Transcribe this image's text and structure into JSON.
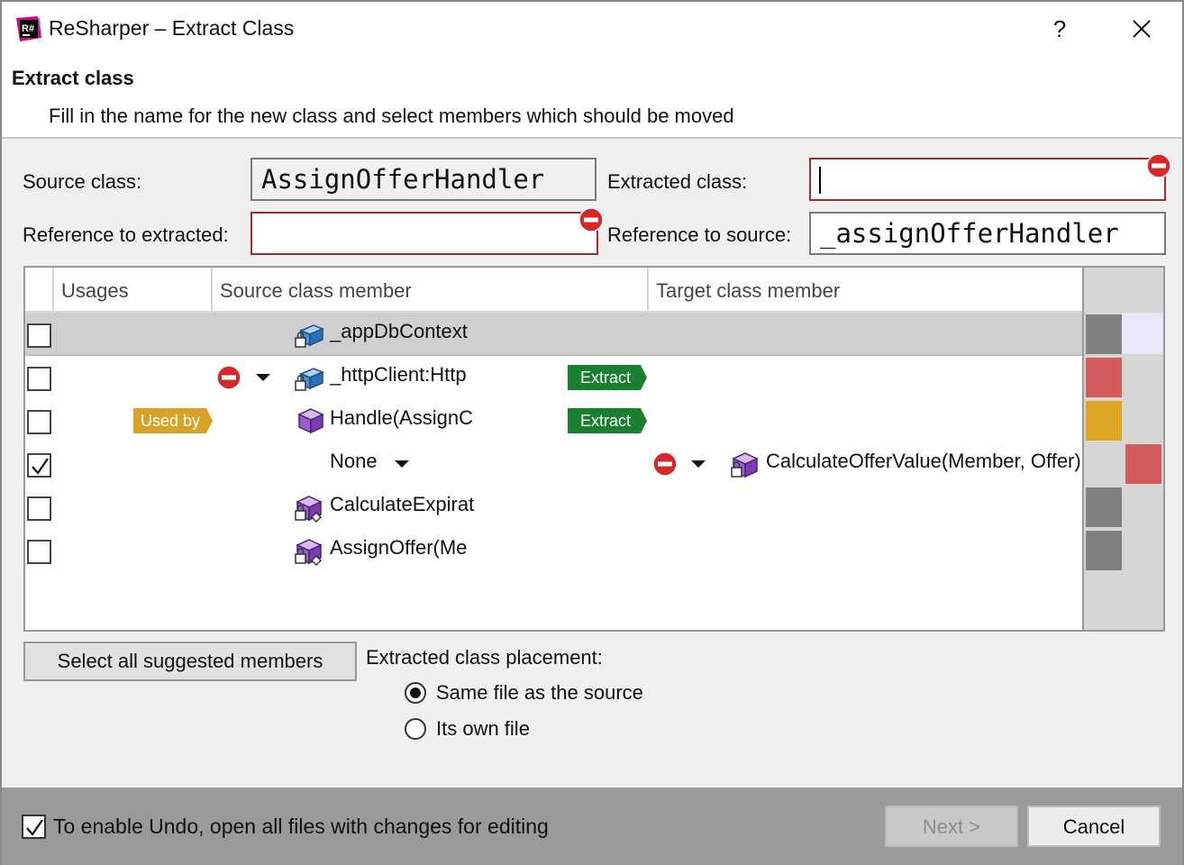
{
  "window": {
    "title": "ReSharper – Extract Class",
    "help_label": "?",
    "app_icon_text": "R#"
  },
  "header": {
    "title": "Extract class",
    "subtitle": "Fill in the name for the new class and select members which should be moved"
  },
  "form": {
    "source_class_label": "Source class:",
    "source_class_value": "AssignOfferHandler",
    "extracted_class_label": "Extracted class:",
    "extracted_class_value": "",
    "ref_extracted_label": "Reference to extracted:",
    "ref_extracted_value": "",
    "ref_source_label": "Reference to source:",
    "ref_source_value": "_assignOfferHandler"
  },
  "grid": {
    "columns": [
      "Usages",
      "Source class member",
      "Target class member"
    ],
    "rows": [
      {
        "checked": false,
        "member": "_appDbContext",
        "icon": "field-locked-icon",
        "selected": true
      },
      {
        "checked": false,
        "member": "_httpClient:Http",
        "icon": "field-locked-icon",
        "badge": "Extract",
        "error": true
      },
      {
        "checked": false,
        "member": "Handle(AssignC",
        "icon": "method-icon",
        "usage": "Used by",
        "badge": "Extract"
      },
      {
        "checked": true,
        "member": "None",
        "target": "CalculateOfferValue(Member, Offer)",
        "target_icon": "method-locked-icon",
        "error_target": true
      },
      {
        "checked": false,
        "member": "CalculateExpirat",
        "icon": "method-private-locked-icon"
      },
      {
        "checked": false,
        "member": "AssignOffer(Me",
        "icon": "method-private-locked-icon"
      }
    ],
    "side_colors": [
      "#808080",
      "#d45b5b",
      "#dea622",
      "#d45b5b",
      "#808080",
      "#808080"
    ]
  },
  "actions": {
    "select_all_label": "Select all suggested members",
    "placement_label": "Extracted class placement:",
    "placement_options": [
      "Same file as the source",
      "Its own file"
    ],
    "placement_selected": "Same file as the source"
  },
  "footer": {
    "undo_label": "To enable Undo, open all files with changes for editing",
    "undo_checked": true,
    "next_label": "Next >",
    "cancel_label": "Cancel"
  },
  "colors": {
    "error_red": "#d62828",
    "extract_green": "#18802e",
    "usage_amber": "#d9a227"
  }
}
